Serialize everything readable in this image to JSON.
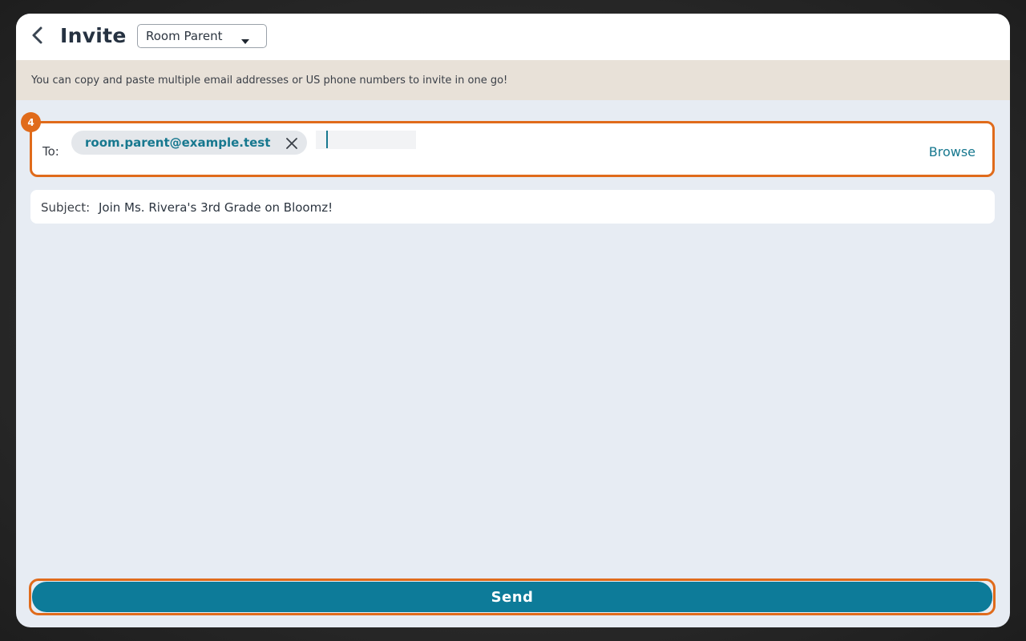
{
  "header": {
    "title": "Invite",
    "role_select": {
      "selected": "Room Parent"
    }
  },
  "banner": {
    "text": "You can copy and paste multiple email addresses or US phone numbers to invite in one go!"
  },
  "recipients": {
    "step_number": "4",
    "to_label": "To:",
    "chips": [
      {
        "email": "room.parent@example.test"
      }
    ],
    "browse_label": "Browse"
  },
  "subject": {
    "label": "Subject:",
    "value": "Join Ms. Rivera's 3rd Grade on Bloomz!"
  },
  "footer": {
    "send_label": "Send"
  },
  "colors": {
    "accent": "#0d7b99",
    "highlight": "#e06b1b",
    "banner_bg": "#e8e1d8",
    "page_bg": "#e7ecf3"
  },
  "icons": {
    "back": "chevron-left-icon",
    "caret": "caret-down-icon",
    "remove_chip": "close-icon"
  }
}
